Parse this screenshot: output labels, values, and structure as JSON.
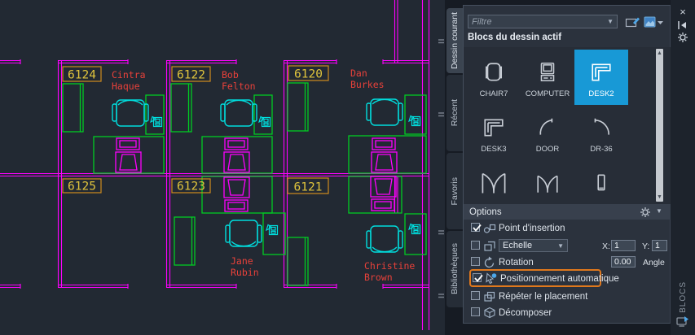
{
  "drawing": {
    "background": "#222933",
    "colors": {
      "wall": "#ff00ff",
      "furniture_green": "#00cc22",
      "seat_cyan": "#00dede",
      "label_border": "#d08c1f",
      "label_text": "#e0c43c",
      "name_text": "#e8413a"
    },
    "rooms": [
      {
        "number": "6124",
        "name1": "Cintra",
        "name2": "Haque"
      },
      {
        "number": "6122",
        "name1": "Bob",
        "name2": "Felton"
      },
      {
        "number": "6120",
        "name1": "Dan",
        "name2": "Burkes"
      },
      {
        "number": "6125",
        "name1": "",
        "name2": ""
      },
      {
        "number": "6123",
        "name1": "Jane",
        "name2": "Rubin"
      },
      {
        "number": "6121",
        "name1": "Christine",
        "name2": "Brown"
      }
    ]
  },
  "palette": {
    "tabs": [
      {
        "label": "Dessin courant",
        "active": true
      },
      {
        "label": "Récent",
        "active": false
      },
      {
        "label": "Favoris",
        "active": false
      },
      {
        "label": "Bibliothèques",
        "active": false
      }
    ],
    "filter": {
      "placeholder": "Filtre"
    },
    "heading": "Blocs du dessin actif",
    "blocks": [
      {
        "name": "CHAIR7",
        "selected": false
      },
      {
        "name": "COMPUTER",
        "selected": false
      },
      {
        "name": "DESK2",
        "selected": true
      },
      {
        "name": "DESK3",
        "selected": false
      },
      {
        "name": "DOOR",
        "selected": false
      },
      {
        "name": "DR-36",
        "selected": false
      }
    ],
    "options": {
      "title": "Options",
      "insertion_point": {
        "label": "Point d'insertion",
        "checked": true
      },
      "scale": {
        "label": "Echelle",
        "checked": false,
        "x_label": "X:",
        "x_value": "1",
        "y_label": "Y:",
        "y_value": "1"
      },
      "rotation": {
        "label": "Rotation",
        "checked": false,
        "value": "0.00",
        "angle_label": "Angle"
      },
      "auto_placement": {
        "label": "Positionnement automatique",
        "checked": true
      },
      "repeat": {
        "label": "Répéter le placement",
        "checked": false
      },
      "explode": {
        "label": "Décomposer",
        "checked": false
      }
    },
    "side_label": "BLOCS",
    "accent_blue": "#1899d6",
    "highlight_orange": "#e0781c"
  }
}
